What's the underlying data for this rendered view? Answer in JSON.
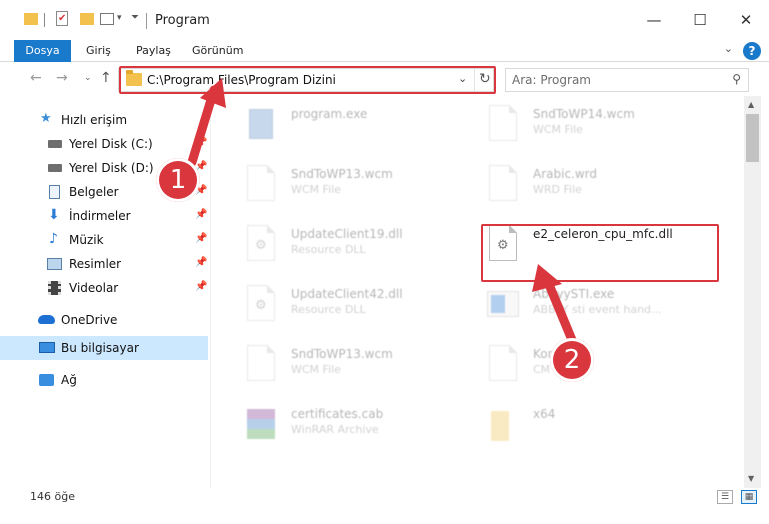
{
  "window": {
    "title": "Program",
    "controls": {
      "minimize": "—",
      "maximize": "☐",
      "close": "✕"
    }
  },
  "ribbon": {
    "tabs": [
      "Dosya",
      "Giriş",
      "Paylaş",
      "Görünüm"
    ],
    "help": "?"
  },
  "nav": {
    "address": "C:\\Program Files\\Program Dizini",
    "search_placeholder": "Ara: Program"
  },
  "sidebar": {
    "items": [
      {
        "label": "Hızlı erişim",
        "icon": "star-icon"
      },
      {
        "label": "Yerel Disk (C:)",
        "icon": "drive-icon"
      },
      {
        "label": "Yerel Disk (D:)",
        "icon": "drive-icon"
      },
      {
        "label": "Belgeler",
        "icon": "documents-icon"
      },
      {
        "label": "İndirmeler",
        "icon": "download-icon"
      },
      {
        "label": "Müzik",
        "icon": "music-icon"
      },
      {
        "label": "Resimler",
        "icon": "pictures-icon"
      },
      {
        "label": "Videolar",
        "icon": "video-icon"
      },
      {
        "label": "OneDrive",
        "icon": "cloud-icon"
      },
      {
        "label": "Bu bilgisayar",
        "icon": "computer-icon"
      },
      {
        "label": "Ağ",
        "icon": "network-icon"
      }
    ]
  },
  "files": [
    {
      "name": "program.exe",
      "type": ""
    },
    {
      "name": "SndToWP14.wcm",
      "type": "WCM File"
    },
    {
      "name": "SndToWP13.wcm",
      "type": "WCM File"
    },
    {
      "name": "Arabic.wrd",
      "type": "WRD File"
    },
    {
      "name": "UpdateClient19.dll",
      "type": "Resource DLL"
    },
    {
      "name": "e2_celeron_cpu_mfc.dll",
      "type": ""
    },
    {
      "name": "UpdateClient42.dll",
      "type": "Resource DLL"
    },
    {
      "name": "AbbyySTI.exe",
      "type": "ABBYY sti event hand..."
    },
    {
      "name": "SndToWP13.wcm",
      "type": "WCM File"
    },
    {
      "name": "Kon",
      "type": "CM"
    },
    {
      "name": "certificates.cab",
      "type": "WinRAR Archive"
    },
    {
      "name": "x64",
      "type": ""
    }
  ],
  "status": {
    "count": "146 öğe"
  },
  "callouts": [
    "1",
    "2"
  ],
  "colors": {
    "accent": "#1979ca",
    "highlight": "#d9363e",
    "selected": "#cce8ff"
  }
}
